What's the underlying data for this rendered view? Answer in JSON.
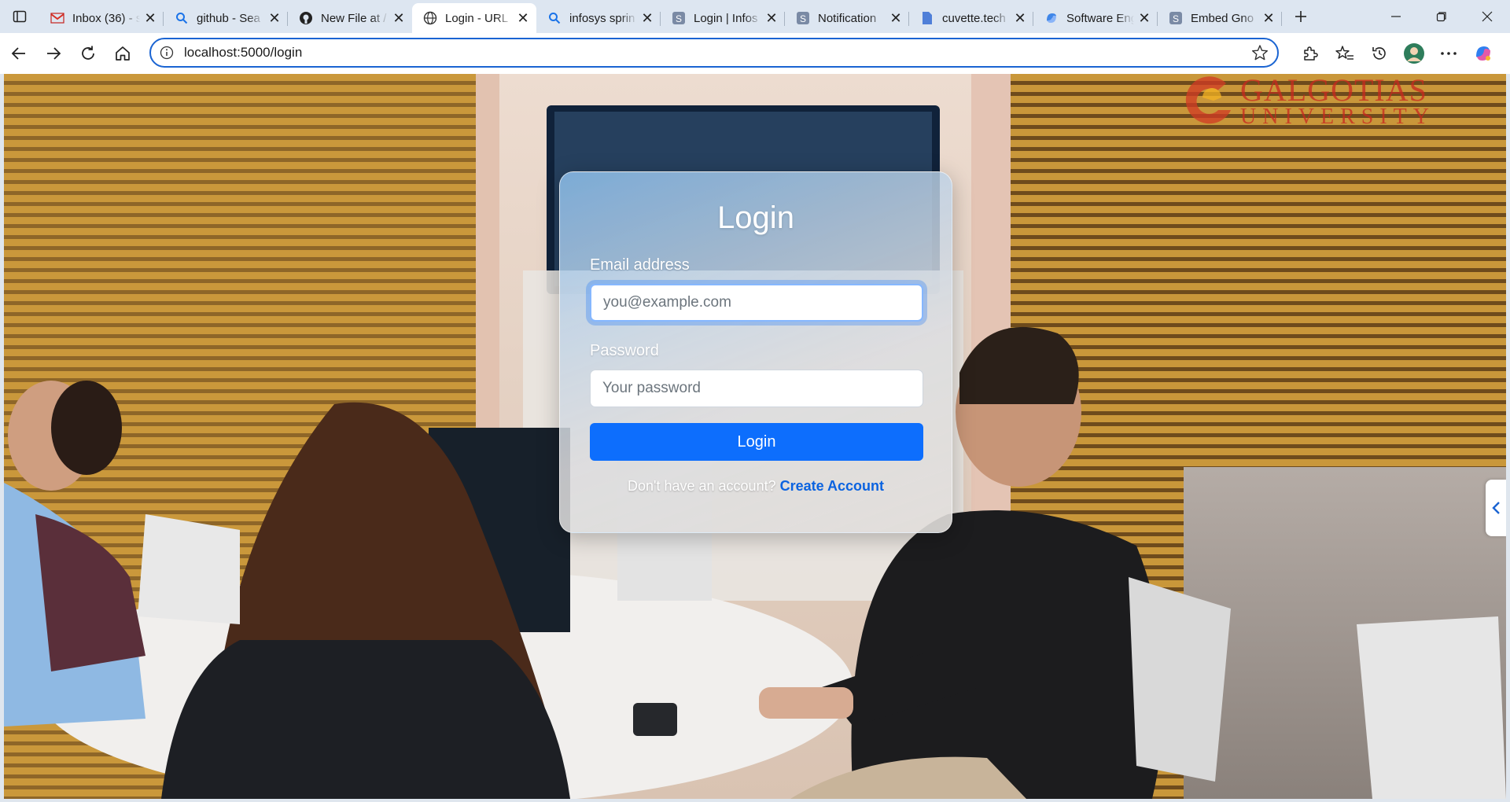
{
  "browser": {
    "tabs": [
      {
        "title": "Inbox (36) - s",
        "icon": "gmail-icon"
      },
      {
        "title": "github - Sea",
        "icon": "search-icon"
      },
      {
        "title": "New File at /",
        "icon": "github-icon"
      },
      {
        "title": "Login - URL",
        "icon": "globe-icon",
        "active": true
      },
      {
        "title": "infosys sprin",
        "icon": "search-icon"
      },
      {
        "title": "Login | Infos",
        "icon": "springboard-icon"
      },
      {
        "title": "Notification",
        "icon": "springboard-icon"
      },
      {
        "title": "cuvette.tech",
        "icon": "document-icon"
      },
      {
        "title": "Software Eng",
        "icon": "copilot-icon"
      },
      {
        "title": "Embed Gno",
        "icon": "springboard-icon"
      }
    ],
    "url": "localhost:5000/login"
  },
  "brand": {
    "name": "GALGOTIAS",
    "sub": "UNIVERSITY",
    "color": "#c8281e"
  },
  "login": {
    "title": "Login",
    "email_label": "Email address",
    "email_placeholder": "you@example.com",
    "password_label": "Password",
    "password_placeholder": "Your password",
    "submit_label": "Login",
    "signup_prompt": "Don't have an account?",
    "signup_link": "Create Account"
  },
  "colors": {
    "accent": "#0d6efd",
    "focus_border": "#1a64d2"
  }
}
